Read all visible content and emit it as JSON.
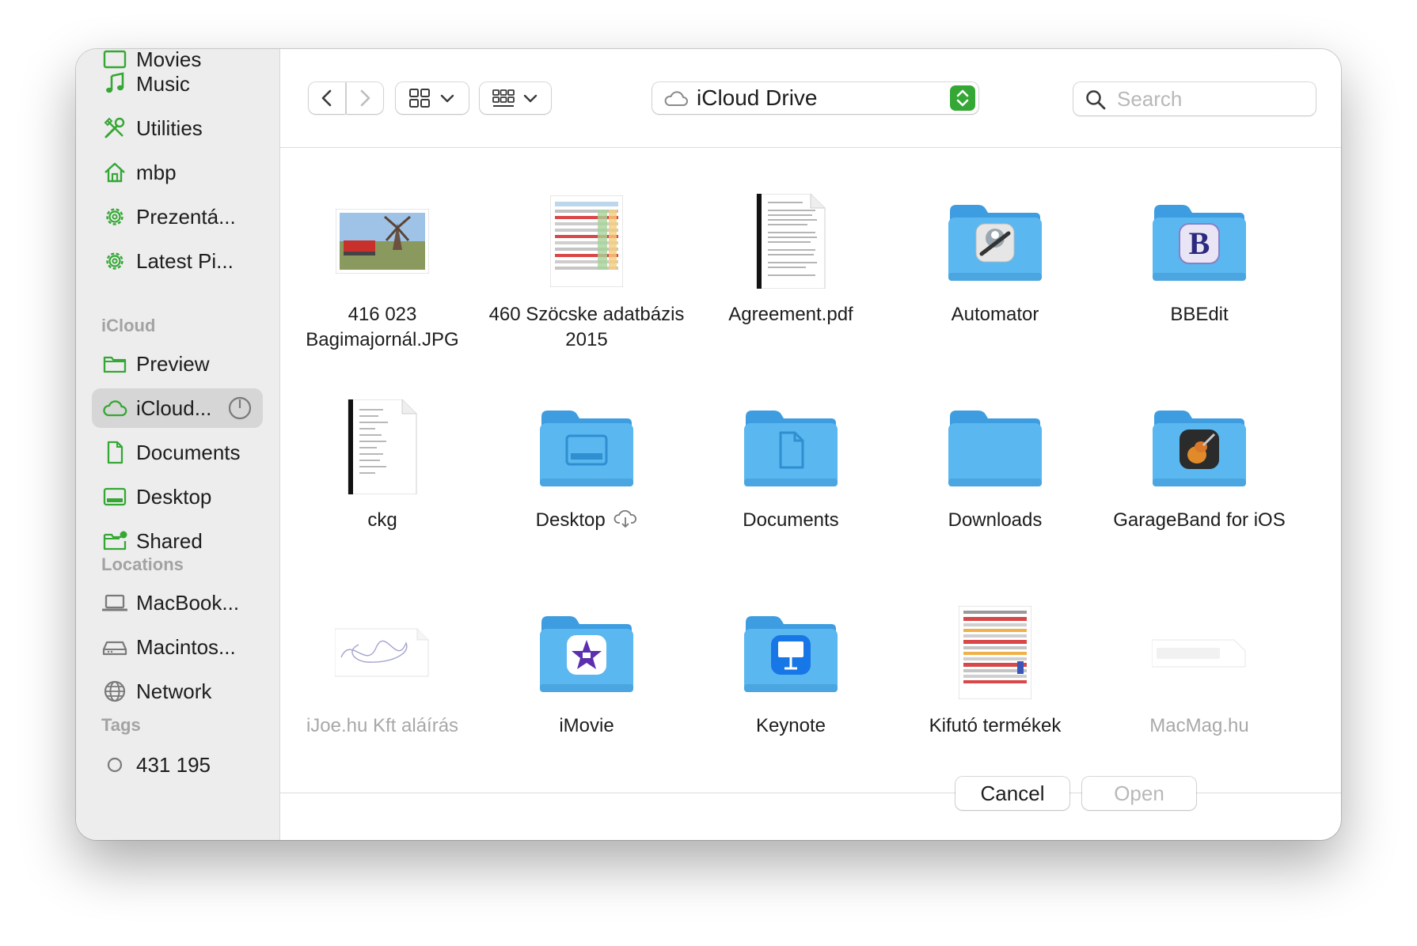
{
  "sidebar": {
    "top_partial_label": "Movies",
    "favorites": [
      {
        "label": "Music",
        "icon": "music-note-icon"
      },
      {
        "label": "Utilities",
        "icon": "tools-icon"
      },
      {
        "label": "mbp",
        "icon": "home-icon"
      },
      {
        "label": "Prezentá...",
        "icon": "gear-icon"
      },
      {
        "label": "Latest Pi...",
        "icon": "gear-icon"
      }
    ],
    "icloud_heading": "iCloud",
    "icloud": [
      {
        "label": "Preview",
        "icon": "folder-icon"
      },
      {
        "label": "iCloud...",
        "icon": "cloud-icon",
        "selected": true
      },
      {
        "label": "Documents",
        "icon": "document-icon"
      },
      {
        "label": "Desktop",
        "icon": "desktop-icon"
      },
      {
        "label": "Shared",
        "icon": "shared-folder-icon"
      }
    ],
    "locations_heading": "Locations",
    "locations": [
      {
        "label": "MacBook...",
        "icon": "laptop-icon"
      },
      {
        "label": "Macintos...",
        "icon": "drive-icon"
      },
      {
        "label": "Network",
        "icon": "globe-icon"
      }
    ],
    "tags_heading": "Tags",
    "tags": [
      {
        "label": "431 195",
        "icon": "tag-circle-icon"
      }
    ]
  },
  "toolbar": {
    "location": "iCloud Drive",
    "search_placeholder": "Search"
  },
  "files": [
    {
      "name": "416 023 Bagimajornál.JPG",
      "kind": "photo"
    },
    {
      "name": "460 Szöcske adatbázis 2015",
      "kind": "spreadsheet"
    },
    {
      "name": "Agreement.pdf",
      "kind": "pdf"
    },
    {
      "name": "Automator",
      "kind": "app-folder"
    },
    {
      "name": "BBEdit",
      "kind": "app-folder"
    },
    {
      "name": "ckg",
      "kind": "pdf"
    },
    {
      "name": "Desktop",
      "kind": "folder"
    },
    {
      "name": "Documents",
      "kind": "folder"
    },
    {
      "name": "Downloads",
      "kind": "folder"
    },
    {
      "name": "GarageBand for iOS",
      "kind": "app-folder"
    },
    {
      "name": "iJoe.hu Kft aláírás",
      "kind": "signature",
      "dim": true
    },
    {
      "name": "iMovie",
      "kind": "app-folder"
    },
    {
      "name": "Keynote",
      "kind": "app-folder"
    },
    {
      "name": "Kifutó termékek",
      "kind": "spreadsheet"
    },
    {
      "name": "MacMag.hu",
      "kind": "logo",
      "dim": true
    }
  ],
  "buttons": {
    "cancel": "Cancel",
    "open": "Open"
  },
  "colors": {
    "accent": "#35a735",
    "folder": "#5ab7ef",
    "folder_tab": "#3d9de0"
  }
}
